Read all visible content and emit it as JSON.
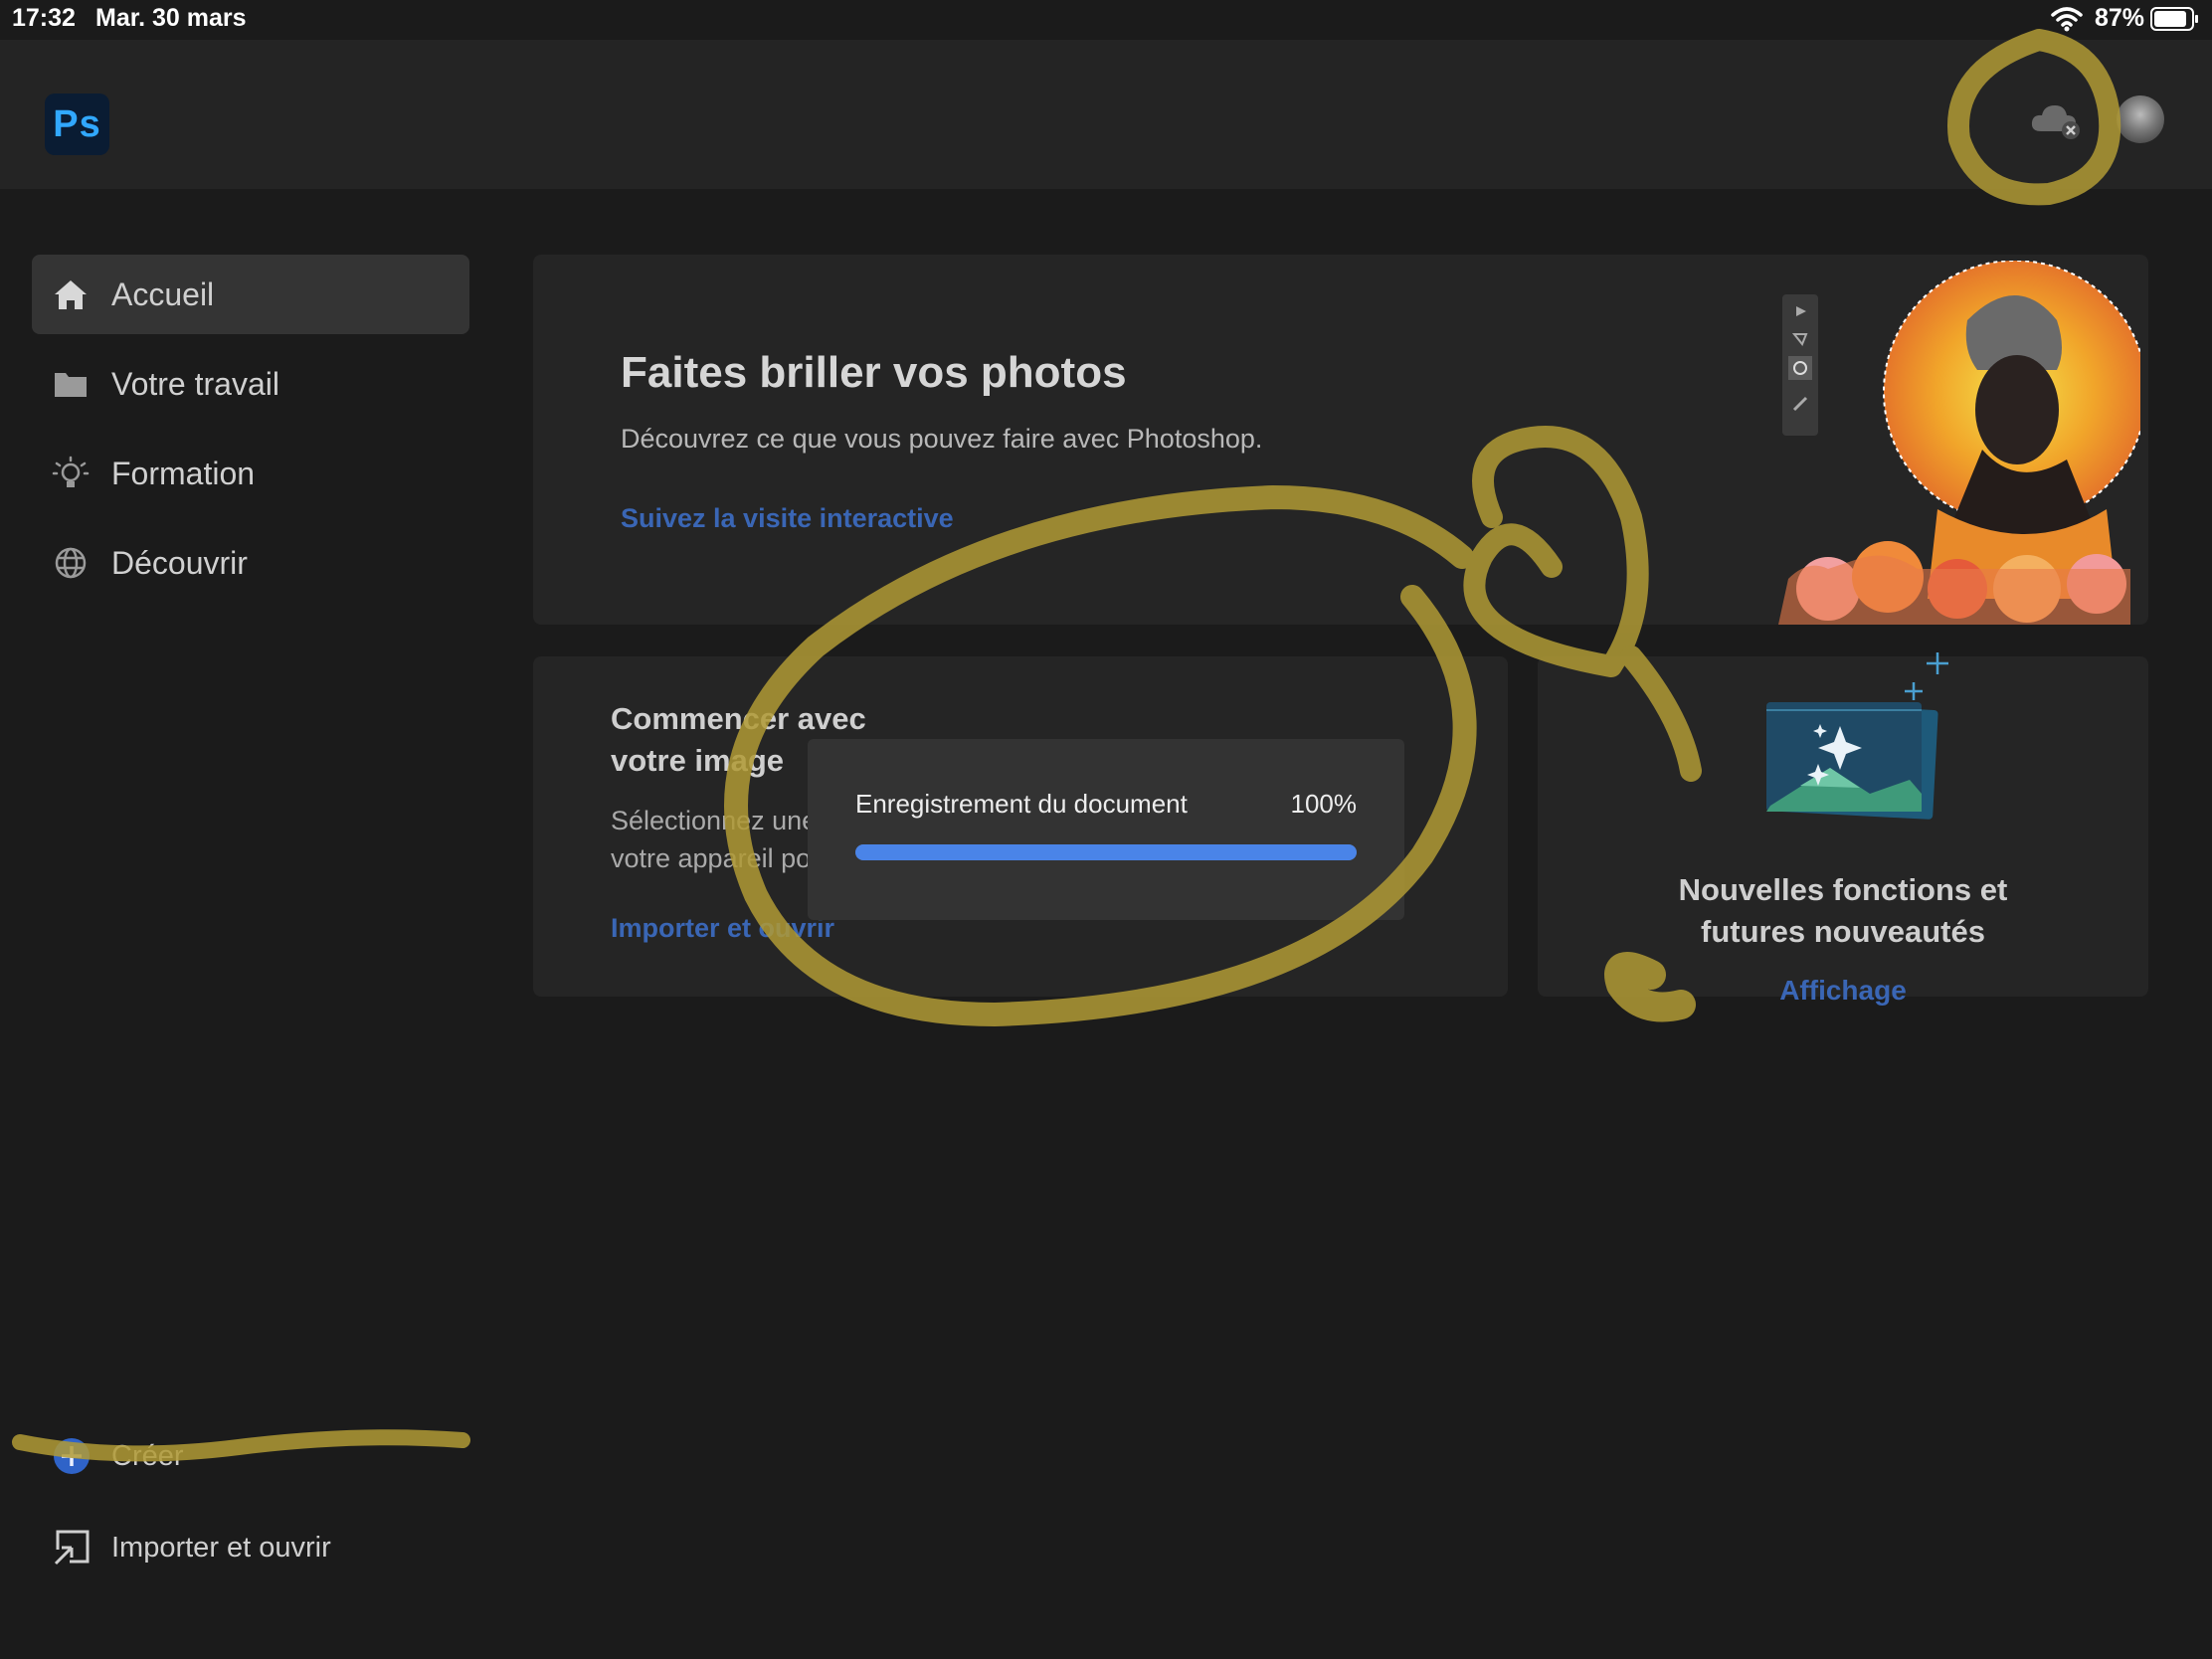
{
  "status_bar": {
    "time": "17:32",
    "date": "Mar. 30 mars",
    "battery": "87%",
    "icons": [
      "wifi-icon",
      "battery-icon"
    ]
  },
  "app": {
    "logo_text": "Ps",
    "accent": "#31a8ff",
    "header_icons": [
      "cloud-offline-icon",
      "avatar"
    ]
  },
  "sidebar": {
    "items": [
      {
        "label": "Accueil",
        "icon": "home-icon",
        "active": true
      },
      {
        "label": "Votre travail",
        "icon": "folder-icon",
        "active": false
      },
      {
        "label": "Formation",
        "icon": "lightbulb-icon",
        "active": false
      },
      {
        "label": "Découvrir",
        "icon": "globe-icon",
        "active": false
      }
    ],
    "bottom": {
      "create_label": "Créer",
      "import_label": "Importer et ouvrir"
    }
  },
  "hero": {
    "title": "Faites briller vos photos",
    "subtitle": "Découvrez ce que vous pouvez faire avec Photoshop.",
    "link": "Suivez la visite interactive"
  },
  "start_card": {
    "title_line1": "Commencer avec",
    "title_line2": "votre image",
    "desc_line1": "Sélectionnez une",
    "desc_line2": "votre appareil po",
    "link": "Importer et ouvrir"
  },
  "new_card": {
    "title_line1": "Nouvelles fonctions et",
    "title_line2": "futures nouveautés",
    "link": "Affichage"
  },
  "dialog": {
    "message": "Enregistrement du document",
    "percent_text": "100%",
    "progress": 1.0
  },
  "colors": {
    "link": "#3a66b5",
    "progress": "#4a84e8",
    "annotation": "#b09a35"
  }
}
